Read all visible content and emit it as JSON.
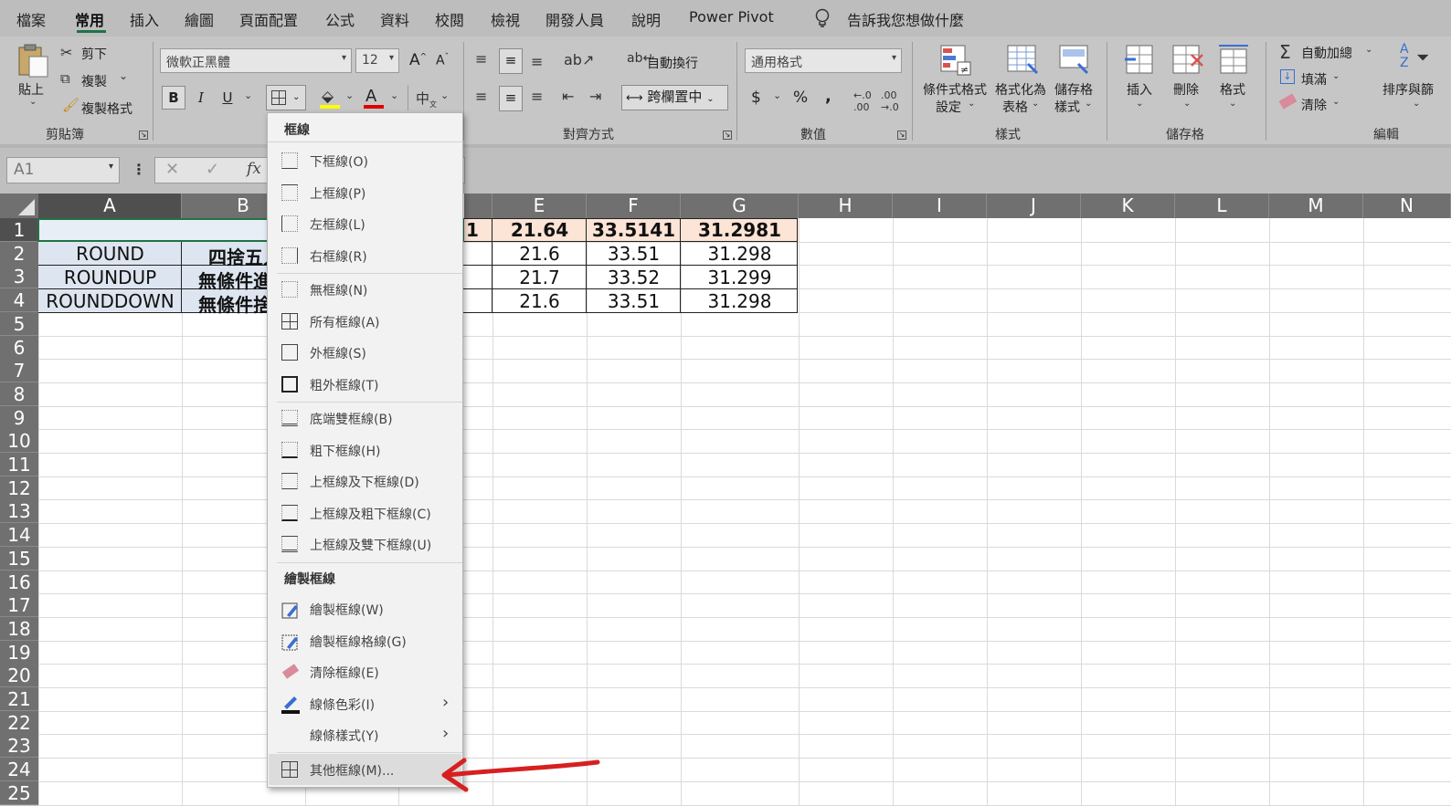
{
  "menu": {
    "tabs": [
      "檔案",
      "常用",
      "插入",
      "繪圖",
      "頁面配置",
      "公式",
      "資料",
      "校閱",
      "檢視",
      "開發人員",
      "說明",
      "Power Pivot"
    ],
    "active": "常用",
    "tell_me": "告訴我您想做什麼"
  },
  "ribbon": {
    "clipboard": {
      "paste": "貼上",
      "cut": "剪下",
      "copy": "複製",
      "format_painter": "複製格式",
      "group": "剪貼簿"
    },
    "font": {
      "name": "微軟正黑體",
      "size": "12",
      "bold": "B",
      "italic": "I",
      "underline": "U",
      "grow": "A",
      "shrink": "A",
      "font_color": "A"
    },
    "alignment": {
      "wrap": "自動換行",
      "merge": "跨欄置中",
      "group": "對齊方式"
    },
    "number": {
      "format": "通用格式",
      "currency": "$",
      "percent": "%",
      "comma": ",",
      "group": "數值"
    },
    "styles": {
      "cond1": "條件式格式",
      "cond2": "設定",
      "table1": "格式化為",
      "table2": "表格",
      "cell1": "儲存格",
      "cell2": "樣式",
      "group": "樣式"
    },
    "cells": {
      "insert": "插入",
      "delete": "刪除",
      "format": "格式",
      "group": "儲存格"
    },
    "editing": {
      "autosum": "自動加總",
      "fill": "填滿",
      "clear": "清除",
      "sort": "排序與篩",
      "group": "編輯"
    }
  },
  "formula_bar": {
    "name_box": "A1",
    "fx": "fx"
  },
  "columns": [
    "A",
    "B",
    "E",
    "F",
    "G",
    "H",
    "I",
    "J",
    "K",
    "L",
    "M",
    "N"
  ],
  "rows": [
    "1",
    "2",
    "3",
    "4",
    "5",
    "6",
    "7",
    "8",
    "9",
    "10",
    "11",
    "12",
    "13",
    "14",
    "15",
    "16",
    "17",
    "18",
    "19",
    "20",
    "21",
    "22",
    "23",
    "24",
    "25"
  ],
  "cells": {
    "A2": "ROUND",
    "A3": "ROUNDUP",
    "A4": "ROUNDDOWN",
    "B2": "四捨五入",
    "B3": "無條件進",
    "B4": "無條件捨",
    "D1": "1",
    "E1": "21.64",
    "F1": "33.5141",
    "G1": "31.2981",
    "E2": "21.6",
    "F2": "33.51",
    "G2": "31.298",
    "E3": "21.7",
    "F3": "33.52",
    "G3": "31.299",
    "E4": "21.6",
    "F4": "33.51",
    "G4": "31.298"
  },
  "dropdown": {
    "header1": "框線",
    "items1": [
      "下框線(O)",
      "上框線(P)",
      "左框線(L)",
      "右框線(R)"
    ],
    "items2": [
      "無框線(N)",
      "所有框線(A)",
      "外框線(S)",
      "粗外框線(T)"
    ],
    "items3": [
      "底端雙框線(B)",
      "粗下框線(H)",
      "上框線及下框線(D)",
      "上框線及粗下框線(C)",
      "上框線及雙下框線(U)"
    ],
    "header2": "繪製框線",
    "items4": [
      "繪製框線(W)",
      "繪製框線格線(G)",
      "清除框線(E)",
      "線條色彩(I)",
      "線條樣式(Y)"
    ],
    "more": "其他框線(M)..."
  },
  "colors": {
    "accent": "#217346",
    "header_fill": "#fce4d6",
    "label_fill": "#dde5f0",
    "arrow": "#d62020"
  }
}
